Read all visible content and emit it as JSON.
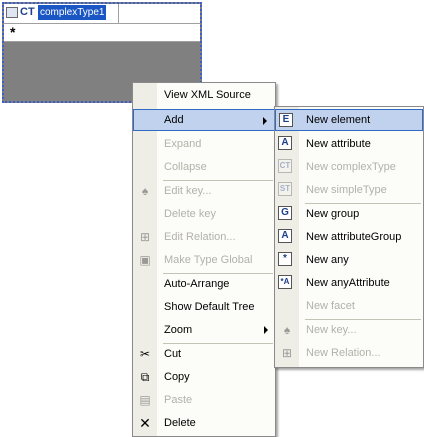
{
  "complex_type": {
    "kind_glyph": "CT",
    "name": "complexType1",
    "add_row_glyph": "*"
  },
  "context_menu": {
    "items": [
      {
        "label": "View XML Source",
        "enabled": true
      },
      {
        "label": "Add",
        "enabled": true,
        "highlighted": true,
        "submenu": true
      },
      {
        "label": "Expand",
        "enabled": false
      },
      {
        "label": "Collapse",
        "enabled": false
      },
      {
        "label": "Edit key...",
        "enabled": false
      },
      {
        "label": "Delete key",
        "enabled": false
      },
      {
        "label": "Edit Relation...",
        "enabled": false
      },
      {
        "label": "Make Type Global",
        "enabled": false
      },
      {
        "label": "Auto-Arrange",
        "enabled": true
      },
      {
        "label": "Show Default Tree",
        "enabled": true
      },
      {
        "label": "Zoom",
        "enabled": true,
        "submenu": true
      },
      {
        "label": "Cut",
        "enabled": true,
        "icon": "scissors-icon"
      },
      {
        "label": "Copy",
        "enabled": true,
        "icon": "copy-icon"
      },
      {
        "label": "Paste",
        "enabled": false,
        "icon": "paste-icon"
      },
      {
        "label": "Delete",
        "enabled": true,
        "icon": "delete-x-icon"
      }
    ]
  },
  "add_submenu": {
    "items": [
      {
        "label": "New element",
        "enabled": true,
        "highlighted": true,
        "icon_glyph": "E"
      },
      {
        "label": "New attribute",
        "enabled": true,
        "icon_glyph": "A"
      },
      {
        "label": "New complexType",
        "enabled": false,
        "icon_glyph": "CT"
      },
      {
        "label": "New simpleType",
        "enabled": false,
        "icon_glyph": "ST"
      },
      {
        "label": "New group",
        "enabled": true,
        "icon_glyph": "G"
      },
      {
        "label": "New attributeGroup",
        "enabled": true,
        "icon_glyph": "A"
      },
      {
        "label": "New any",
        "enabled": true,
        "icon_glyph": "*"
      },
      {
        "label": "New anyAttribute",
        "enabled": true,
        "icon_glyph": "*A"
      },
      {
        "label": "New facet",
        "enabled": false
      },
      {
        "label": "New key...",
        "enabled": false,
        "icon": "key-icon"
      },
      {
        "label": "New Relation...",
        "enabled": false,
        "icon": "relation-icon"
      }
    ]
  }
}
